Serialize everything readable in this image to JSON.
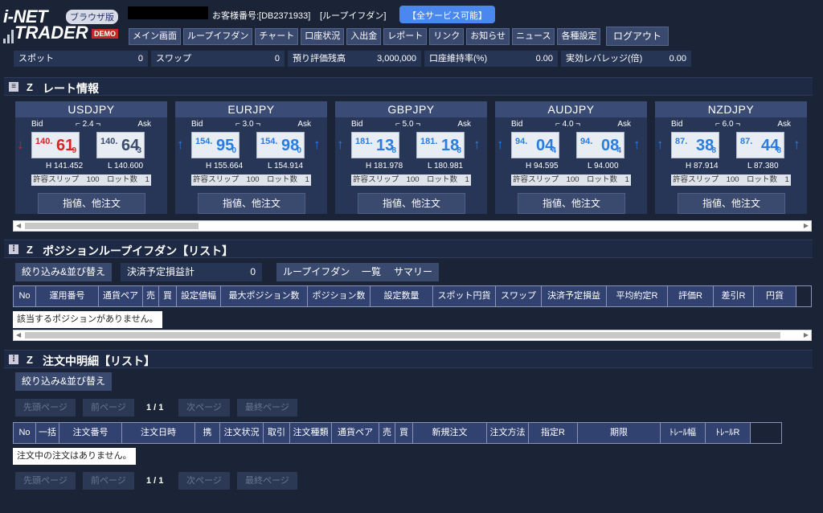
{
  "header": {
    "logo_line1": "i-NET",
    "logo_line2": "TRADER",
    "browser_badge": "ブラウザ版",
    "demo_badge": "DEMO",
    "customer_no": "お客様番号:[DB2371933]",
    "service_name": "[ループイフダン]",
    "service_badge": "【全サービス可能】",
    "logout": "ログアウト"
  },
  "nav": [
    "メイン画面",
    "ループイフダン",
    "チャート",
    "口座状況",
    "入出金",
    "レポート",
    "リンク",
    "お知らせ",
    "ニュース",
    "各種設定"
  ],
  "summary": [
    {
      "label": "スポット",
      "value": "0"
    },
    {
      "label": "スワップ",
      "value": "0"
    },
    {
      "label": "預り評価残高",
      "value": "3,000,000"
    },
    {
      "label": "口座維持率(%)",
      "value": "0.00"
    },
    {
      "label": "実効レバレッジ(倍)",
      "value": "0.00"
    }
  ],
  "rate_section": {
    "title": "レート情報"
  },
  "rates": [
    {
      "pair": "USDJPY",
      "bid_label": "Bid",
      "ask_label": "Ask",
      "spread": "2.4",
      "bid_small": "140.",
      "bid_big": "61",
      "bid_pip": "9",
      "ask_small": "140.",
      "ask_big": "64",
      "ask_pip": "3",
      "high": "H 141.452",
      "low": "L 140.600",
      "slip": "許容スリップ　100　ロット数　1",
      "order": "指値、他注文",
      "dir": "down"
    },
    {
      "pair": "EURJPY",
      "bid_label": "Bid",
      "ask_label": "Ask",
      "spread": "3.0",
      "bid_small": "154.",
      "bid_big": "95",
      "bid_pip": "0",
      "ask_small": "154.",
      "ask_big": "98",
      "ask_pip": "0",
      "high": "H 155.664",
      "low": "L 154.914",
      "slip": "許容スリップ　100　ロット数　1",
      "order": "指値、他注文",
      "dir": "up"
    },
    {
      "pair": "GBPJPY",
      "bid_label": "Bid",
      "ask_label": "Ask",
      "spread": "5.0",
      "bid_small": "181.",
      "bid_big": "13",
      "bid_pip": "8",
      "ask_small": "181.",
      "ask_big": "18",
      "ask_pip": "8",
      "high": "H 181.978",
      "low": "L 180.981",
      "slip": "許容スリップ　100　ロット数　1",
      "order": "指値、他注文",
      "dir": "up"
    },
    {
      "pair": "AUDJPY",
      "bid_label": "Bid",
      "ask_label": "Ask",
      "spread": "4.0",
      "bid_small": "94.",
      "bid_big": "04",
      "bid_pip": "4",
      "ask_small": "94.",
      "ask_big": "08",
      "ask_pip": "4",
      "high": "H 94.595",
      "low": "L 94.000",
      "slip": "許容スリップ　100　ロット数　1",
      "order": "指値、他注文",
      "dir": "up"
    },
    {
      "pair": "NZDJPY",
      "bid_label": "Bid",
      "ask_label": "Ask",
      "spread": "6.0",
      "bid_small": "87.",
      "bid_big": "38",
      "bid_pip": "8",
      "ask_small": "87.",
      "ask_big": "44",
      "ask_pip": "8",
      "high": "H 87.914",
      "low": "L 87.380",
      "slip": "許容スリップ　100　ロット数　1",
      "order": "指値、他注文",
      "dir": "up"
    }
  ],
  "position_section": {
    "title": "ポジションループイフダン【リスト】",
    "filter": "絞り込み&並び替え",
    "pl_label": "決済予定損益計",
    "pl_value": "0",
    "btn_loop": "ループイフダン",
    "btn_list": "一覧",
    "btn_summary": "サマリー",
    "columns": [
      "No",
      "運用番号",
      "通貨ペア",
      "売",
      "買",
      "設定値幅",
      "最大ポジション数",
      "ポジション数",
      "設定数量",
      "スポット円貨",
      "スワップ",
      "決済予定損益",
      "平均約定R",
      "評価R",
      "差引R",
      "円貨"
    ],
    "empty": "該当するポジションがありません。"
  },
  "order_section": {
    "title": "注文中明細【リスト】",
    "filter": "絞り込み&並び替え",
    "pager": {
      "first": "先頭ページ",
      "prev": "前ページ",
      "page": "1 / 1",
      "next": "次ページ",
      "last": "最終ページ"
    },
    "columns": [
      "No",
      "一括",
      "注文番号",
      "注文日時",
      "携",
      "注文状況",
      "取引",
      "注文種類",
      "通貨ペア",
      "売",
      "買",
      "新規注文",
      "注文方法",
      "指定R",
      "期限",
      "ﾄﾚｰﾙ幅",
      "ﾄﾚｰﾙR"
    ],
    "empty": "注文中の注文はありません。"
  }
}
